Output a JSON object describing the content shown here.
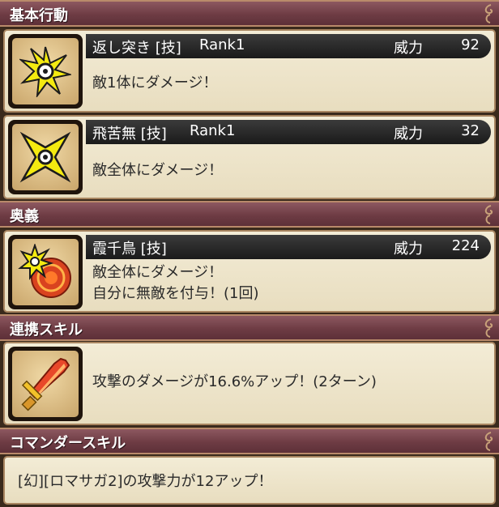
{
  "sections": {
    "basic": {
      "title": "基本行動"
    },
    "ougi": {
      "title": "奥義"
    },
    "renkei": {
      "title": "連携スキル"
    },
    "commander": {
      "title": "コマンダースキル"
    }
  },
  "skills": [
    {
      "name": "返し突き [技]",
      "rank": "Rank1",
      "power_label": "威力",
      "power": "92",
      "desc": "敵1体にダメージ！",
      "icon": "shuriken-icon"
    },
    {
      "name": "飛苦無 [技]",
      "rank": "Rank1",
      "power_label": "威力",
      "power": "32",
      "desc": "敵全体にダメージ！",
      "icon": "kunai-icon"
    },
    {
      "name": "霞千鳥 [技]",
      "power_label": "威力",
      "power": "224",
      "desc1": "敵全体にダメージ！",
      "desc2": "自分に無敵を付与！(1回)",
      "icon": "ougi-swirl-icon"
    }
  ],
  "renkei_skill": {
    "desc": "攻撃のダメージが16.6%アップ！(2ターン)",
    "icon": "flame-sword-icon"
  },
  "commander_skill": {
    "desc": "[幻][ロマサガ2]の攻撃力が12アップ！"
  },
  "colors": {
    "header": "#6e3c44",
    "card": "#f0e8d0",
    "namebar": "#222222",
    "accent_yellow": "#f5e61a"
  }
}
